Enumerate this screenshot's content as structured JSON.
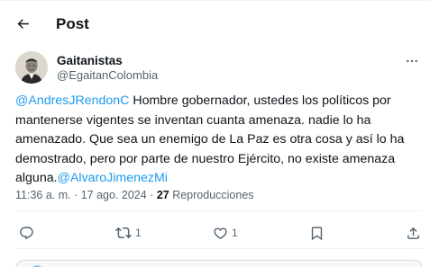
{
  "header": {
    "title": "Post"
  },
  "author": {
    "name": "Gaitanistas",
    "handle": "@EgaitanColombia"
  },
  "post": {
    "lines": [
      {
        "mention": "@AndresJRendonC",
        "text": " Hombre gobernador, ustedes los políticos por"
      },
      {
        "text": "mantenerse vigentes se inventan cuanta amenaza. nadie lo ha"
      },
      {
        "text": "amenazado. Que sea un enemigo de La Paz es otra cosa y así lo ha"
      },
      {
        "text": "demostrado, pero por parte de nuestro Ejército, no existe amenaza"
      },
      {
        "text": "alguna.",
        "mention": "@AlvaroJimenezMi"
      }
    ]
  },
  "meta": {
    "time": "11:36 a. m.",
    "separator": " · ",
    "date": "17 ago. 2024",
    "views_count": "27",
    "views_label": " Reproducciones"
  },
  "actions": {
    "reply_count": "",
    "repost_count": "1",
    "like_count": "1"
  },
  "icons": {
    "back": "arrow-left-icon",
    "more": "more-horizontal-icon",
    "reply": "reply-icon",
    "repost": "repost-icon",
    "like": "heart-icon",
    "bookmark": "bookmark-icon",
    "share": "share-icon"
  },
  "colors": {
    "accent": "#1d9bf0",
    "text": "#0f1419",
    "secondary": "#536471",
    "border": "#eff3f4"
  }
}
